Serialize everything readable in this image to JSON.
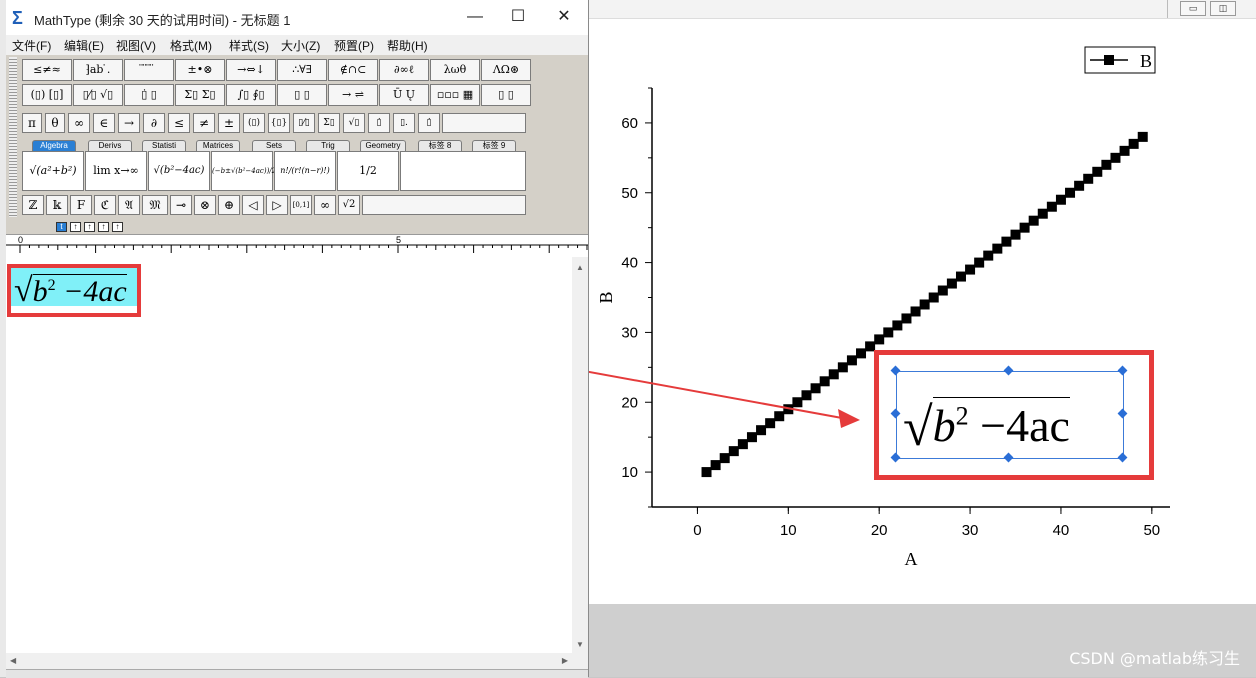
{
  "mathtype": {
    "title": "MathType (剩余 30 天的试用时间) - 无标题 1",
    "menu": [
      "文件(F)",
      "编辑(E)",
      "视图(V)",
      "格式(M)",
      "样式(S)",
      "大小(Z)",
      "预置(P)",
      "帮助(H)"
    ],
    "palette_row1": [
      "≤≠≈",
      "⁆ab ̇.",
      "̈ ̈ ̈ ̈",
      "±•⊗",
      "→⇔↓",
      "∴∀∃",
      "∉∩⊂",
      "∂∞ℓ",
      "λωθ",
      "ΛΩ⊛"
    ],
    "palette_row2": [
      "(▯) [▯]",
      "▯⁄▯ √▯",
      "▯̇ ▯",
      "Σ▯ Σ▯",
      "∫▯ ∮▯",
      "▯ ▯",
      "→ ⇌",
      "Ū Ų",
      "▫▫▫ ▦",
      "▯ ▯"
    ],
    "symbols_row": [
      "π",
      "θ",
      "∞",
      "∈",
      "→",
      "∂",
      "≤",
      "≠",
      "±",
      "(▯)",
      "{▯}",
      "▯⁄▯",
      "Σ▯",
      "√▯",
      "▯̇",
      "▯.",
      "▯̇"
    ],
    "tabs": [
      "Algebra",
      "Derivs",
      "Statisti",
      "Matrices",
      "Sets",
      "Trig",
      "Geometry",
      "标签 8",
      "标签 9"
    ],
    "templates": [
      "√(a²+b²)",
      "lim x→∞",
      "√(b²−4ac)",
      "(−b±√(b²−4ac))/2a",
      "n!/(r!(n−r)!)",
      "1/2"
    ],
    "bottom_row": [
      "ℤ",
      "𝕜",
      "F",
      "ℭ",
      "𝔄",
      "𝔐",
      "⊸",
      "⊗",
      "⊕",
      "◁",
      "▷",
      "[0,1]",
      "∞",
      "√2"
    ],
    "ruler_labels": [
      "0",
      "5"
    ],
    "equation": {
      "base": "b",
      "sup": "2",
      "rest": "−4ac"
    }
  },
  "chart_data": {
    "type": "scatter",
    "title": "",
    "xlabel": "A",
    "ylabel": "B",
    "legend": {
      "labels": [
        "B"
      ],
      "placement": "top-right"
    },
    "xlim": [
      -5,
      52
    ],
    "ylim": [
      5,
      65
    ],
    "xticks": [
      0,
      10,
      20,
      30,
      40,
      50
    ],
    "yticks": [
      10,
      20,
      30,
      40,
      50,
      60
    ],
    "series": [
      {
        "name": "B",
        "x": [
          1,
          2,
          3,
          4,
          5,
          6,
          7,
          8,
          9,
          10,
          11,
          12,
          13,
          14,
          15,
          16,
          17,
          18,
          19,
          20,
          21,
          22,
          23,
          24,
          25,
          26,
          27,
          28,
          29,
          30,
          31,
          32,
          33,
          34,
          35,
          36,
          37,
          38,
          39,
          40,
          41,
          42,
          43,
          44,
          45,
          46,
          47,
          48,
          49
        ],
        "y": [
          10,
          11,
          12,
          13,
          14,
          15,
          16,
          17,
          18,
          19,
          20,
          21,
          22,
          23,
          24,
          25,
          26,
          27,
          28,
          29,
          30,
          31,
          32,
          33,
          34,
          35,
          36,
          37,
          38,
          39,
          40,
          41,
          42,
          43,
          44,
          45,
          46,
          47,
          48,
          49,
          50,
          51,
          52,
          53,
          54,
          55,
          56,
          57,
          58
        ]
      }
    ],
    "marker": "square",
    "color": "#000000",
    "grid": false
  },
  "embedded_equation": {
    "base": "b",
    "sup": "2",
    "rest": "−4ac"
  },
  "watermark": "CSDN @matlab练习生"
}
